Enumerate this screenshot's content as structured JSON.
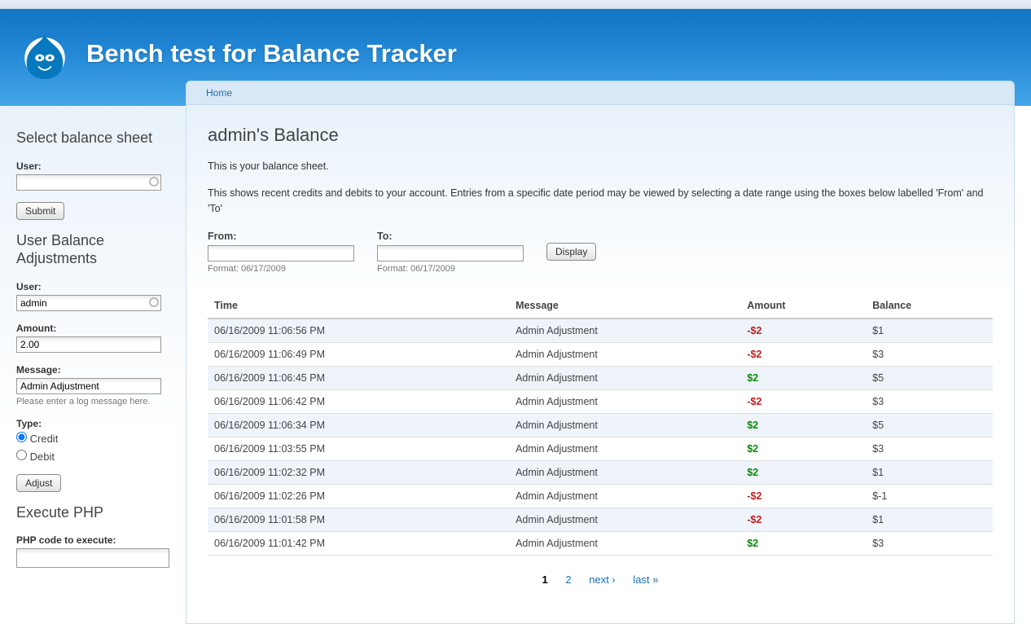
{
  "site": {
    "title": "Bench test for Balance Tracker"
  },
  "breadcrumb": {
    "home": "Home"
  },
  "sidebar": {
    "select_sheet": {
      "heading": "Select balance sheet",
      "user_label": "User:",
      "user_value": "",
      "submit": "Submit"
    },
    "adjust": {
      "heading": "User Balance Adjustments",
      "user_label": "User:",
      "user_value": "admin",
      "amount_label": "Amount:",
      "amount_value": "2.00",
      "message_label": "Message:",
      "message_value": "Admin Adjustment",
      "message_hint": "Please enter a log message here.",
      "type_label": "Type:",
      "type_credit": "Credit",
      "type_debit": "Debit",
      "type_selected": "credit",
      "submit": "Adjust"
    },
    "php": {
      "heading": "Execute PHP",
      "label": "PHP code to execute:",
      "value": ""
    }
  },
  "page": {
    "title": "admin's Balance",
    "intro1": "This is your balance sheet.",
    "intro2": "This shows recent credits and debits to your account. Entries from a specific date period may be viewed by selecting a date range using the boxes below labelled 'From' and 'To'",
    "from_label": "From:",
    "from_value": "",
    "from_hint": "Format: 06/17/2009",
    "to_label": "To:",
    "to_value": "",
    "to_hint": "Format: 06/17/2009",
    "display": "Display"
  },
  "table": {
    "headers": {
      "time": "Time",
      "message": "Message",
      "amount": "Amount",
      "balance": "Balance"
    },
    "rows": [
      {
        "time": "06/16/2009 11:06:56 PM",
        "message": "Admin Adjustment",
        "amount": "-$2",
        "amount_sign": "neg",
        "balance": "$1"
      },
      {
        "time": "06/16/2009 11:06:49 PM",
        "message": "Admin Adjustment",
        "amount": "-$2",
        "amount_sign": "neg",
        "balance": "$3"
      },
      {
        "time": "06/16/2009 11:06:45 PM",
        "message": "Admin Adjustment",
        "amount": "$2",
        "amount_sign": "pos",
        "balance": "$5"
      },
      {
        "time": "06/16/2009 11:06:42 PM",
        "message": "Admin Adjustment",
        "amount": "-$2",
        "amount_sign": "neg",
        "balance": "$3"
      },
      {
        "time": "06/16/2009 11:06:34 PM",
        "message": "Admin Adjustment",
        "amount": "$2",
        "amount_sign": "pos",
        "balance": "$5"
      },
      {
        "time": "06/16/2009 11:03:55 PM",
        "message": "Admin Adjustment",
        "amount": "$2",
        "amount_sign": "pos",
        "balance": "$3"
      },
      {
        "time": "06/16/2009 11:02:32 PM",
        "message": "Admin Adjustment",
        "amount": "$2",
        "amount_sign": "pos",
        "balance": "$1"
      },
      {
        "time": "06/16/2009 11:02:26 PM",
        "message": "Admin Adjustment",
        "amount": "-$2",
        "amount_sign": "neg",
        "balance": "$-1"
      },
      {
        "time": "06/16/2009 11:01:58 PM",
        "message": "Admin Adjustment",
        "amount": "-$2",
        "amount_sign": "neg",
        "balance": "$1"
      },
      {
        "time": "06/16/2009 11:01:42 PM",
        "message": "Admin Adjustment",
        "amount": "$2",
        "amount_sign": "pos",
        "balance": "$3"
      }
    ]
  },
  "pager": {
    "current": "1",
    "page2": "2",
    "next": "next ›",
    "last": "last »"
  }
}
